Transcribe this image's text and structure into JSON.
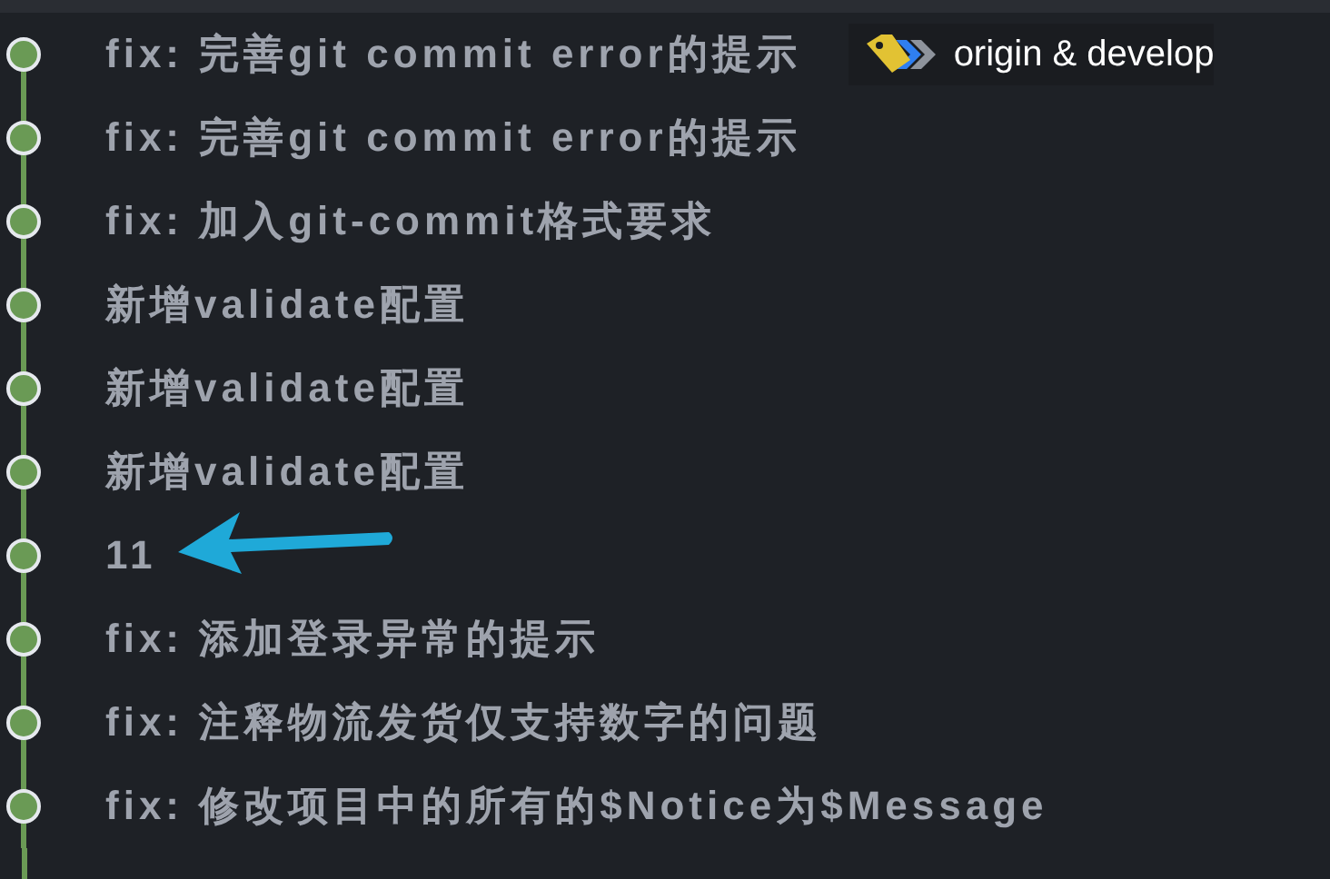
{
  "commits": [
    {
      "message": "fix: 完善git commit error的提示",
      "refs": [
        {
          "label": "origin & develop"
        }
      ]
    },
    {
      "message": "fix: 完善git commit error的提示"
    },
    {
      "message": "fix: 加入git-commit格式要求"
    },
    {
      "message": "新增validate配置"
    },
    {
      "message": "新增validate配置"
    },
    {
      "message": "新增validate配置"
    },
    {
      "message": "11",
      "annotation": {
        "kind": "arrow"
      }
    },
    {
      "message": "fix: 添加登录异常的提示"
    },
    {
      "message": "fix: 注释物流发货仅支持数字的问题"
    },
    {
      "message": "fix: 修改项目中的所有的$Notice为$Message"
    }
  ]
}
